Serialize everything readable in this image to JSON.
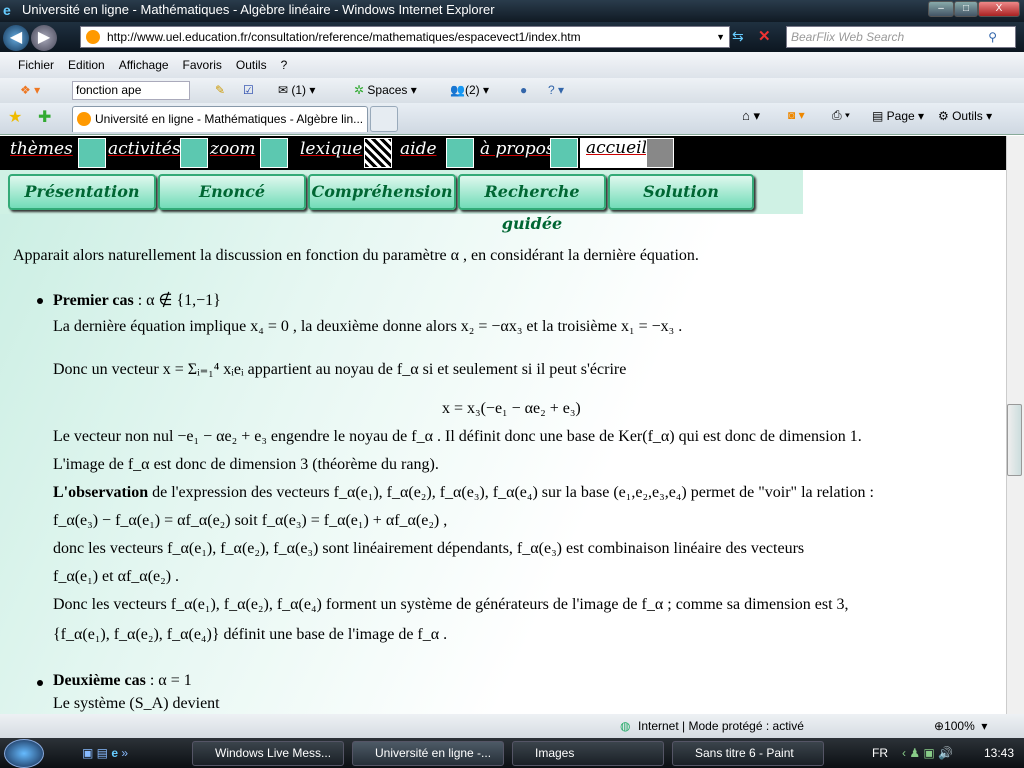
{
  "window": {
    "title": "Université en ligne - Mathématiques - Algèbre linéaire - Windows Internet Explorer",
    "min": "–",
    "max": "□",
    "close": "X"
  },
  "address": {
    "url": "http://www.uel.education.fr/consultation/reference/mathematiques/espacevect1/index.htm",
    "search_placeholder": "BearFlix Web Search"
  },
  "menu": [
    "Fichier",
    "Edition",
    "Affichage",
    "Favoris",
    "Outils",
    "?"
  ],
  "toolbar": {
    "search_value": "fonction ape",
    "mail": "(1)",
    "spaces": "Spaces",
    "contacts": "(2)"
  },
  "tab": {
    "label": "Université en ligne - Mathématiques - Algèbre lin...",
    "page": "Page",
    "tools": "Outils"
  },
  "sitenav": [
    "thèmes",
    "activités",
    "zoom",
    "lexique",
    "aide",
    "à propos",
    "accueil"
  ],
  "sections": [
    "Présentation",
    "Enoncé",
    "Compréhension",
    "Recherche guidée",
    "Solution"
  ],
  "body": {
    "intro": "Apparait alors naturellement la discussion en fonction du paramètre α , en considérant la dernière équation.",
    "case1_title": "Premier cas",
    "case1_cond": ": α ∉ {1,−1}",
    "l1": "La dernière équation implique  x₄ = 0 , la deuxième donne alors  x₂ = −αx₃  et la troisième  x₁ = −x₃ .",
    "l2": "Donc un vecteur  x = Σᵢ₌₁⁴ xᵢeᵢ  appartient au noyau de  f_α  si et seulement si il peut s'écrire",
    "l3": "x = x₃(−e₁ − αe₂ + e₃)",
    "l4": "Le vecteur non nul −e₁ − αe₂ + e₃  engendre le noyau de  f_α . Il définit donc une base de Ker(f_α)  qui est donc de dimension 1.",
    "l5": "L'image de  f_α  est donc de dimension 3 (théorème du rang).",
    "l6_bold": "L'observation",
    "l6": " de l'expression des vecteurs  f_α(e₁), f_α(e₂), f_α(e₃), f_α(e₄)  sur la base  (e₁,e₂,e₃,e₄)  permet de \"voir\" la relation :",
    "l7": "f_α(e₃) − f_α(e₁) = αf_α(e₂)  soit  f_α(e₃) = f_α(e₁) + αf_α(e₂) ,",
    "l8": "donc les vecteurs  f_α(e₁), f_α(e₂), f_α(e₃) sont linéairement dépendants,  f_α(e₃)  est combinaison linéaire des vecteurs",
    "l9": "f_α(e₁)  et αf_α(e₂) .",
    "l10": "Donc les vecteurs  f_α(e₁), f_α(e₂), f_α(e₄)  forment un système de générateurs de l'image de  f_α  ; comme sa dimension est 3,",
    "l11": "{f_α(e₁), f_α(e₂), f_α(e₄)}  définit une base de l'image de  f_α .",
    "case2_title": "Deuxième cas",
    "case2_cond": ": α = 1",
    "l12": "Le système  (S_A)  devient"
  },
  "status": {
    "zone": "Internet | Mode protégé : activé",
    "zoom": "100%"
  },
  "taskbar": {
    "tasks": [
      "Windows Live Mess...",
      "Université en ligne -...",
      "Images",
      "Sans titre 6 - Paint"
    ],
    "lang": "FR",
    "time": "13:43"
  }
}
